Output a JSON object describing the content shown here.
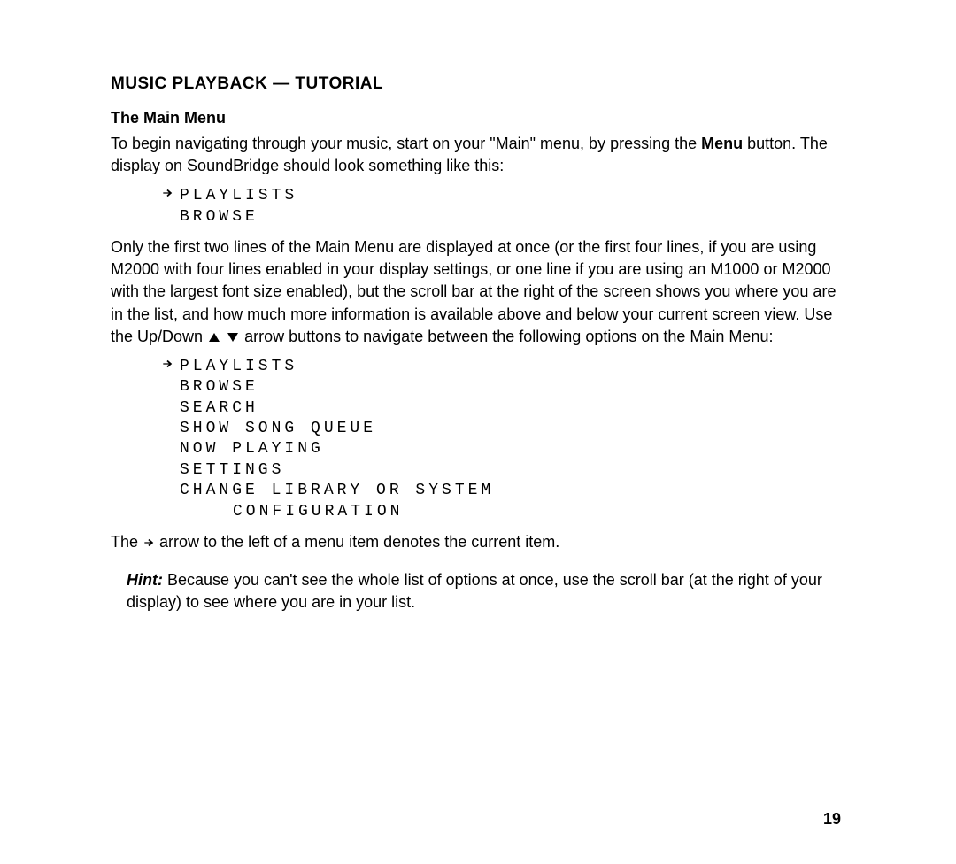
{
  "section_title": "MUSIC PLAYBACK — TUTORIAL",
  "sub_title": "The Main Menu",
  "para1_pre": "To begin navigating through your music, start on your \"Main\" menu, by pressing the ",
  "para1_bold": "Menu",
  "para1_post": " button.  The display on SoundBridge should look something like this:",
  "display1": {
    "row1": "Playlists",
    "row2": "Browse"
  },
  "para2_pre": "Only the first two lines of the Main Menu are displayed at once (or the first four lines, if you are using M2000 with four lines enabled in your display settings, or one line if you are using an M1000 or M2000 with the largest font size enabled), but the scroll bar at the right of the screen shows you where you are in the list, and how much more information is available above and below your current screen view. Use the Up/Down ",
  "para2_post": " arrow buttons to navigate between the following options on the Main Menu:",
  "display2": {
    "row1": "Playlists",
    "row2": "Browse",
    "row3": "Search",
    "row4": "Show Song Queue",
    "row5": "Now Playing",
    "row6": "Settings",
    "row7": "Change Library or System",
    "row8": "Configuration"
  },
  "para3_pre": "The ",
  "para3_post": " arrow to the left of a menu item denotes the current item.",
  "hint_label": "Hint:",
  "hint_text": " Because you can't see the whole list of options at once, use the scroll bar (at the right of your display) to see where you are in your list.",
  "page_number": "19"
}
